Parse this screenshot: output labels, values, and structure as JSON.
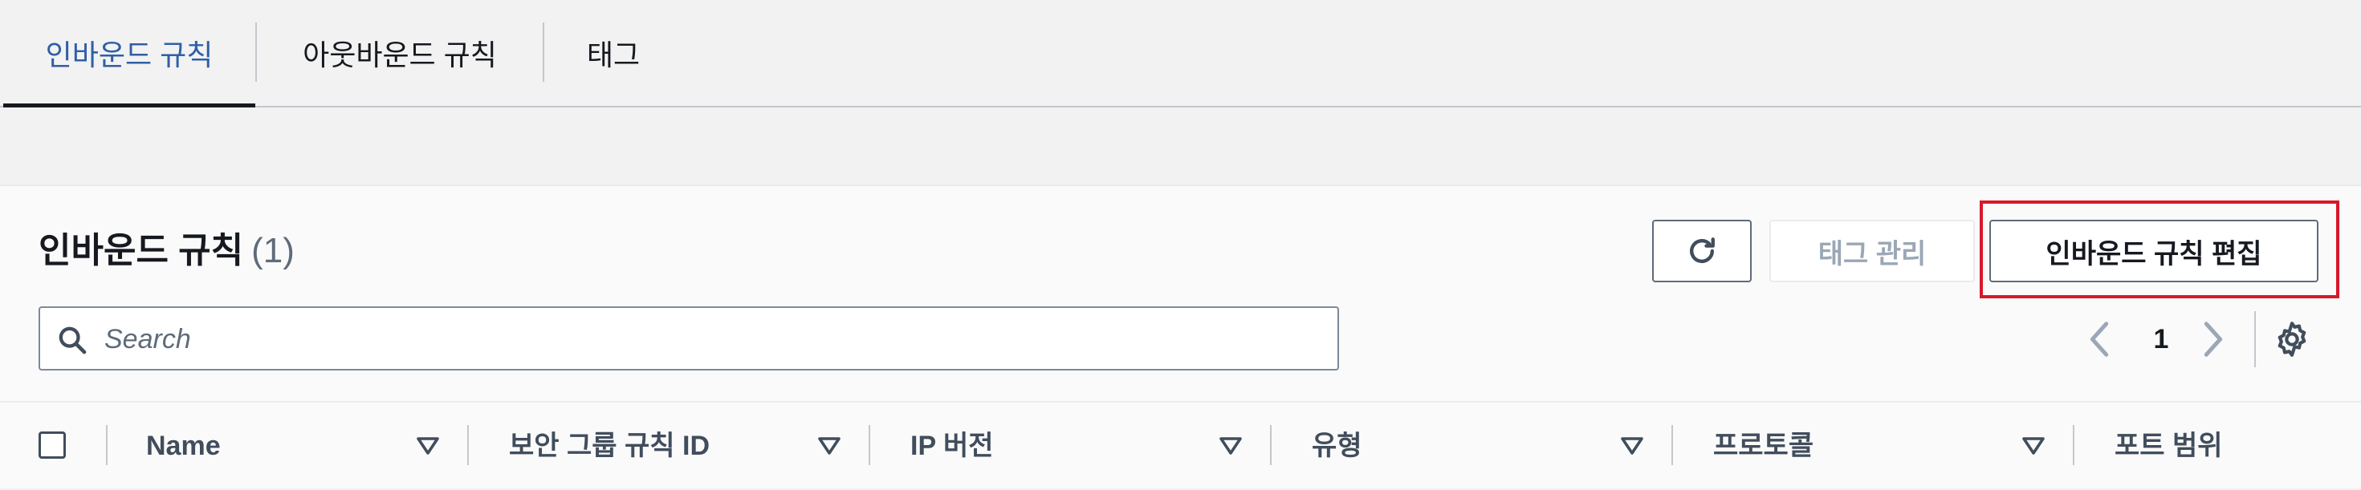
{
  "tabs": [
    {
      "label": "인바운드 규칙",
      "active": true
    },
    {
      "label": "아웃바운드 규칙",
      "active": false
    },
    {
      "label": "태그",
      "active": false
    }
  ],
  "panel": {
    "title": "인바운드 규칙",
    "count": "(1)",
    "buttons": {
      "refresh_icon": "refresh-icon",
      "manage_tags": "태그 관리",
      "manage_tags_disabled": true,
      "edit_rules": "인바운드 규칙 편집"
    },
    "search": {
      "placeholder": "Search",
      "value": ""
    },
    "pagination": {
      "current_page": "1"
    }
  },
  "table": {
    "columns": [
      "Name",
      "보안 그룹 규칙 ID",
      "IP 버전",
      "유형",
      "프로토콜",
      "포트 범위"
    ]
  },
  "colors": {
    "active_tab": "#2f5fa7",
    "highlight": "#d7182a",
    "background": "#f2f2f2",
    "panel": "#fafafa"
  }
}
